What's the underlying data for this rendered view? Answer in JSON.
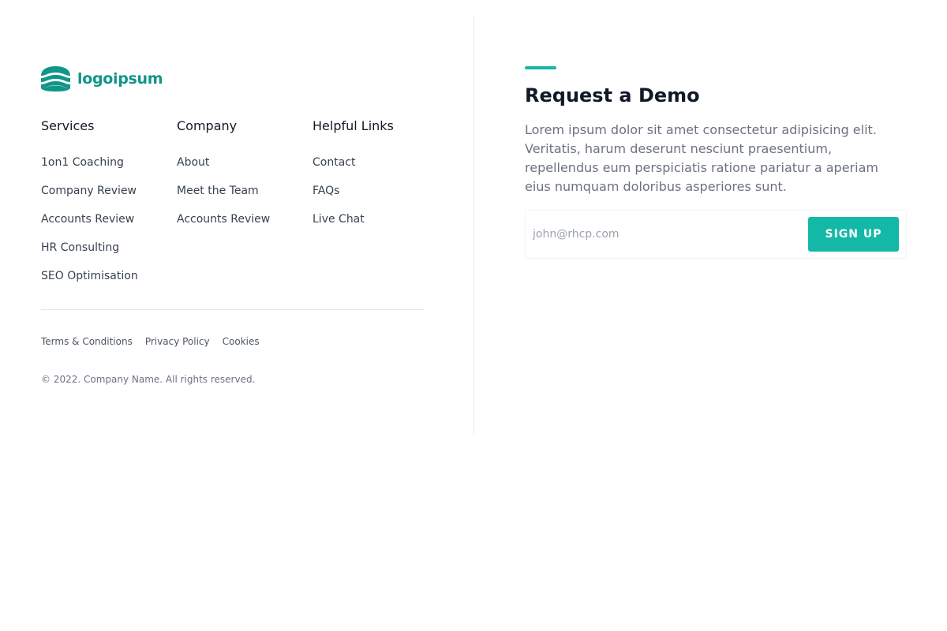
{
  "brand": {
    "name": "logoipsum",
    "logo_icon": "waves-icon",
    "color": "#109688"
  },
  "columns": {
    "services": {
      "heading": "Services",
      "items": [
        "1on1 Coaching",
        "Company Review",
        "Accounts Review",
        "HR Consulting",
        "SEO Optimisation"
      ]
    },
    "company": {
      "heading": "Company",
      "items": [
        "About",
        "Meet the Team",
        "Accounts Review"
      ]
    },
    "helpful": {
      "heading": "Helpful Links",
      "items": [
        "Contact",
        "FAQs",
        "Live Chat"
      ]
    }
  },
  "legal": {
    "links": [
      "Terms & Conditions",
      "Privacy Policy",
      "Cookies"
    ]
  },
  "copyright": "© 2022. Company Name. All rights reserved.",
  "demo": {
    "title": "Request a Demo",
    "description": "Lorem ipsum dolor sit amet consectetur adipisicing elit. Veritatis, harum deserunt nesciunt praesentium, repellendus eum perspiciatis ratione pariatur a aperiam eius numquam doloribus asperiores sunt.",
    "email_placeholder": "john@rhcp.com",
    "email_value": "",
    "button_label": "SIGN UP",
    "accent_color": "#14b8a6"
  }
}
